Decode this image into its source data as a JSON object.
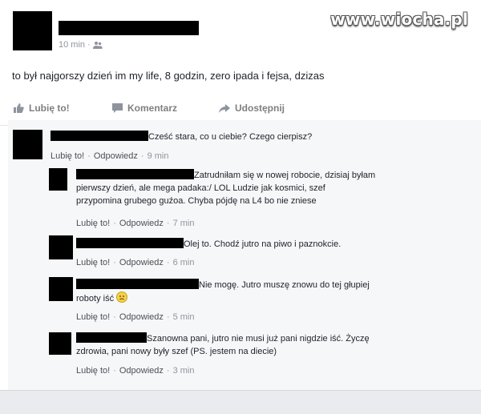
{
  "watermark": "www.wiocha.pl",
  "post": {
    "time": "10 min",
    "text": "to był najgorszy dzień im my life, 8 godzin, zero ipada i fejsa, dzizas"
  },
  "actions": {
    "like": "Lubię to!",
    "comment": "Komentarz",
    "share": "Udostępnij"
  },
  "comment_links": {
    "like": "Lubię to!",
    "reply": "Odpowiedz",
    "sep": "·"
  },
  "comments": [
    {
      "line1": "Cześć stara, co u ciebie? Czego cierpisz?",
      "time": "9 min"
    },
    {
      "line1": "Zatrudniłam się w nowej robocie, dzisiaj byłam",
      "line2": "pierwszy dzień, ale mega padaka:/ LOL Ludzie jak kosmici, szef",
      "line3": "przypomina grubego guźoa. Chyba pójdę na L4 bo nie zniese",
      "time": "7 min"
    },
    {
      "line1": "Olej to. Chodź jutro na piwo i paznokcie.",
      "time": "6 min"
    },
    {
      "line1": "Nie mogę. Jutro muszę znowu do tej głupiej",
      "line2": "roboty iść",
      "emoji": "sad-face",
      "time": "5 min"
    },
    {
      "line1": "Szanowna pani, jutro nie musi już pani nigdzie iść. Życzę",
      "line2": "zdrowia, pani nowy były szef (PS. jestem na diecie)",
      "time": "3 min"
    }
  ]
}
